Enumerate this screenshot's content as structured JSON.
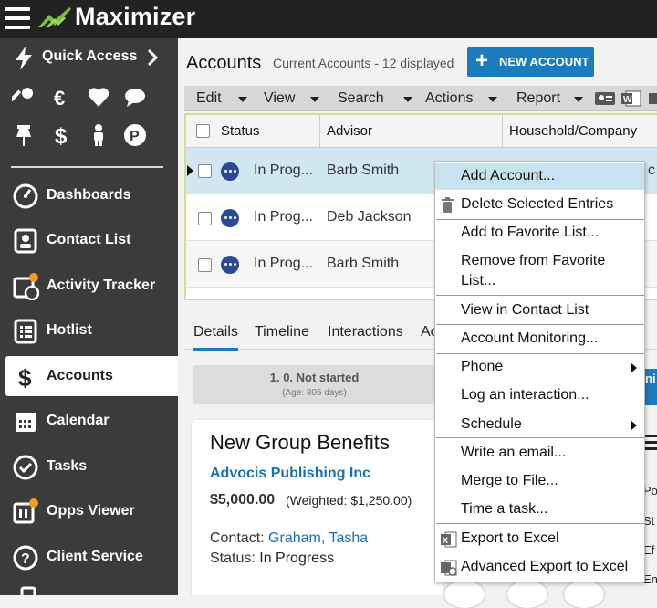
{
  "app": {
    "name": "Maximizer"
  },
  "sidebar": {
    "quick_access": "Quick Access",
    "quick_icons": [
      "key-icon",
      "euro-icon",
      "heart-icon",
      "chat-icon",
      "pin-icon",
      "dollar-icon",
      "person-icon",
      "parking-icon"
    ],
    "items": [
      {
        "label": "Dashboards",
        "icon": "dashboard-icon"
      },
      {
        "label": "Contact List",
        "icon": "contact-card-icon"
      },
      {
        "label": "Activity Tracker",
        "icon": "activity-tracker-icon"
      },
      {
        "label": "Hotlist",
        "icon": "hotlist-icon"
      },
      {
        "label": "Accounts",
        "icon": "dollar-icon",
        "active": true
      },
      {
        "label": "Calendar",
        "icon": "calendar-icon"
      },
      {
        "label": "Tasks",
        "icon": "check-circle-icon"
      },
      {
        "label": "Opps Viewer",
        "icon": "opps-viewer-icon"
      },
      {
        "label": "Client Service",
        "icon": "question-icon"
      }
    ]
  },
  "header": {
    "title": "Accounts",
    "subtitle": "Current Accounts - 12 displayed",
    "new_button": "NEW ACCOUNT"
  },
  "menubar": {
    "items": [
      "Edit",
      "View",
      "Search",
      "Actions",
      "Report"
    ]
  },
  "grid": {
    "columns": [
      "Status",
      "Advisor",
      "Household/Company"
    ],
    "rows": [
      {
        "status": "In Prog...",
        "advisor": "Barb Smith",
        "extra": "c"
      },
      {
        "status": "In Prog...",
        "advisor": "Deb Jackson",
        "extra": ""
      },
      {
        "status": "In Prog...",
        "advisor": "Barb Smith",
        "extra": ""
      }
    ]
  },
  "tabs": [
    "Details",
    "Timeline",
    "Interactions",
    "Ac"
  ],
  "stage": {
    "title": "1. 0. Not started",
    "age": "(Age: 805 days)"
  },
  "card": {
    "title": "New Group Benefits",
    "company": "Advocis Publishing Inc",
    "amount": "$5,000.00",
    "weighted": "(Weighted: $1,250.00)",
    "contact_label": "Contact:",
    "contact": "Graham, Tasha",
    "status_label": "Status:",
    "status": "In Progress"
  },
  "context_menu": {
    "items": [
      "Add Account...",
      "Delete Selected Entries",
      "Add to Favorite List...",
      "Remove from Favorite",
      "List...",
      "View in Contact List",
      "Account Monitoring...",
      "Phone",
      "Log an interaction...",
      "Schedule",
      "Write an email...",
      "Merge to File...",
      "Time a task...",
      "Export to Excel",
      "Advanced Export to Excel"
    ]
  },
  "right_edge": {
    "badge": "ni",
    "lines": [
      "Po",
      "St",
      "Ef",
      "En"
    ]
  },
  "colors": {
    "accent": "#1a7bbd",
    "sidebar": "#3b3b3b",
    "header": "#222222",
    "selection": "#d1e7f1",
    "logo_green": "#7ac143",
    "status_icon": "#2b4a93"
  }
}
